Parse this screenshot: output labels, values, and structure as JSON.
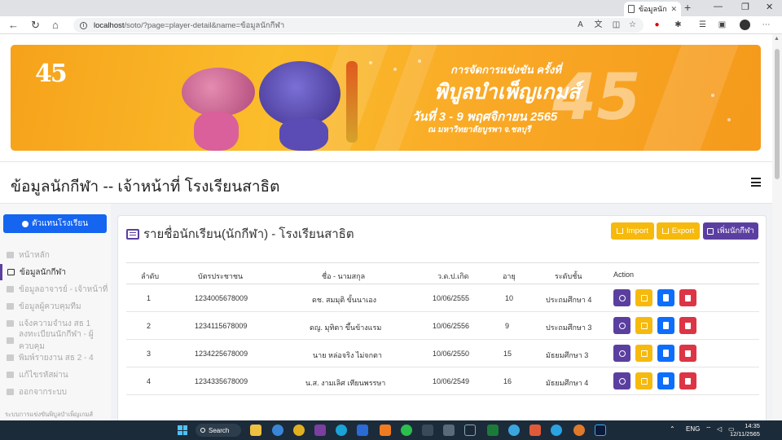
{
  "browser": {
    "tab_title": "ข้อมูลนักกีฬา",
    "url_host": "localhost",
    "url_path": "/soto/?page=player-detail&name=ข้อมูลนักกีฬา"
  },
  "banner": {
    "logo": "45",
    "line1": "การจัดการแข่งขัน ครั้งที่",
    "line2": "พิบูลบำเพ็ญเกมส์",
    "line3": "วันที่ 3 - 9 พฤศจิกายน 2565",
    "line4": "ณ มหาวิทยาลัยบูรพา จ.ชลบุรี",
    "number": "45"
  },
  "header": {
    "title": "ข้อมูลนักกีฬา -- เจ้าหน้าที่ โรงเรียนสาธิต"
  },
  "sidebar": {
    "rep_button": "ตัวแทนโรงเรียน",
    "items": [
      {
        "label": "หน้าหลัก"
      },
      {
        "label": "ข้อมูลนักกีฬา"
      },
      {
        "label": "ข้อมูลอาจารย์ - เจ้าหน้าที่"
      },
      {
        "label": "ข้อมูลผู้ควบคุมทีม"
      },
      {
        "label": "แจ้งความจำนง สธ 1"
      },
      {
        "label": "ลงทะเบียนนักกีฬา - ผู้ควบคุม"
      },
      {
        "label": "พิมพ์รายงาน สธ 2 - 4"
      },
      {
        "label": "แก้ไขรหัสผ่าน"
      },
      {
        "label": "ออกจากระบบ"
      }
    ],
    "footer": "ระบบการแข่งขันพิบูลบำเพ็ญเกมส์"
  },
  "card": {
    "title": "รายชื่อนักเรียน(นักกีฬา) - โรงเรียนสาธิต",
    "import_label": "Import",
    "export_label": "Export",
    "add_label": "เพิ่มนักกีฬา"
  },
  "table": {
    "headers": [
      "ลำดับ",
      "บัตรประชาชน",
      "ชื่อ - นามสกุล",
      "ว.ด.ป.เกิด",
      "อายุ",
      "ระดับชั้น",
      "Action"
    ],
    "rows": [
      [
        "1",
        "1234005678009",
        "ดช. สมมุติ ขั้นนาเอง",
        "10/06/2555",
        "10",
        "ประถมศึกษา 4"
      ],
      [
        "2",
        "1234115678009",
        "ดญ. มุทิตา ขึ้นข้างแรม",
        "10/06/2556",
        "9",
        "ประถมศึกษา 3"
      ],
      [
        "3",
        "1234225678009",
        "นาย หล่อจริง ไม่จกตา",
        "10/06/2550",
        "15",
        "มัธยมศึกษา 3"
      ],
      [
        "4",
        "1234335678009",
        "น.ส. งามเลิศ เทียนพรรษา",
        "10/06/2549",
        "16",
        "มัธยมศึกษา 4"
      ]
    ]
  },
  "taskbar": {
    "search_label": "Search",
    "lang": "ENG",
    "time": "14:35",
    "date": "12/11/2565"
  },
  "colors": {
    "primary": "#5b3fa0",
    "warning": "#f6b90e",
    "info": "#0d6efd",
    "danger": "#dc3545",
    "side_button": "#1565f0"
  }
}
